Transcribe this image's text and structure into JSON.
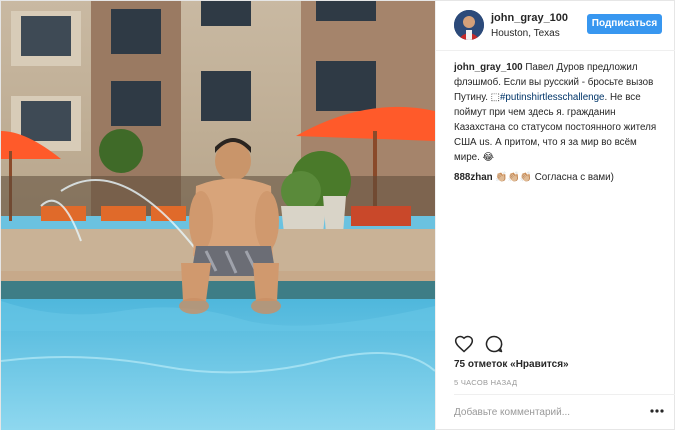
{
  "header": {
    "username": "john_gray_100",
    "location": "Houston, Texas",
    "follow_label": "Подписаться"
  },
  "comments": [
    {
      "user": "john_gray_100",
      "text_before": " Павел Дуров предложил флэшмоб. Если вы русский - бросьте вызов Путину. ⬚",
      "hashtag": "#putinshirtlesschallenge",
      "text_after": ". Не все поймут при чем здесь я. гражданин Казахстана со статусом постоянного жителя США us. А притом, что я за мир во всём мире. 😂"
    },
    {
      "user": "888zhan",
      "text_before": " 👏🏼👏🏼👏🏼 Согласна с вами)",
      "hashtag": "",
      "text_after": ""
    }
  ],
  "actions": {
    "like_icon": "heart-icon",
    "comment_icon": "comment-bubble-icon"
  },
  "likes_text": "75 отметок «Нравится»",
  "timestamp": "5 часов назад",
  "comment_input": {
    "placeholder": "Добавьте комментарий..."
  },
  "more_icon": "ellipsis-icon",
  "colors": {
    "accent": "#3897f0",
    "hashtag": "#003569",
    "muted": "#999999"
  }
}
